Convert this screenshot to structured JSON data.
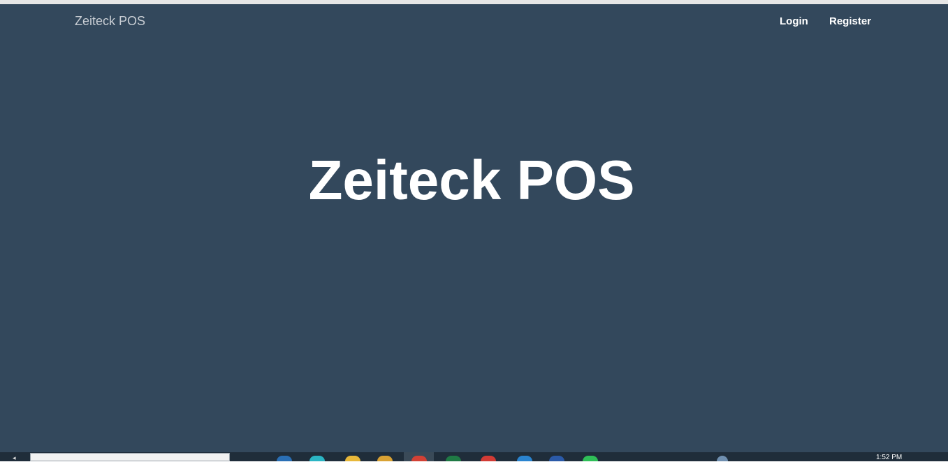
{
  "navbar": {
    "brand": "Zeiteck POS",
    "links": [
      {
        "label": "Login"
      },
      {
        "label": "Register"
      }
    ]
  },
  "hero": {
    "title": "Zeiteck POS"
  },
  "taskbar": {
    "clock": "1:52 PM"
  },
  "colors": {
    "background": "#263a4e",
    "pattern": "#34495d",
    "brand_text": "#c9ced4",
    "link_text": "#ffffff"
  }
}
